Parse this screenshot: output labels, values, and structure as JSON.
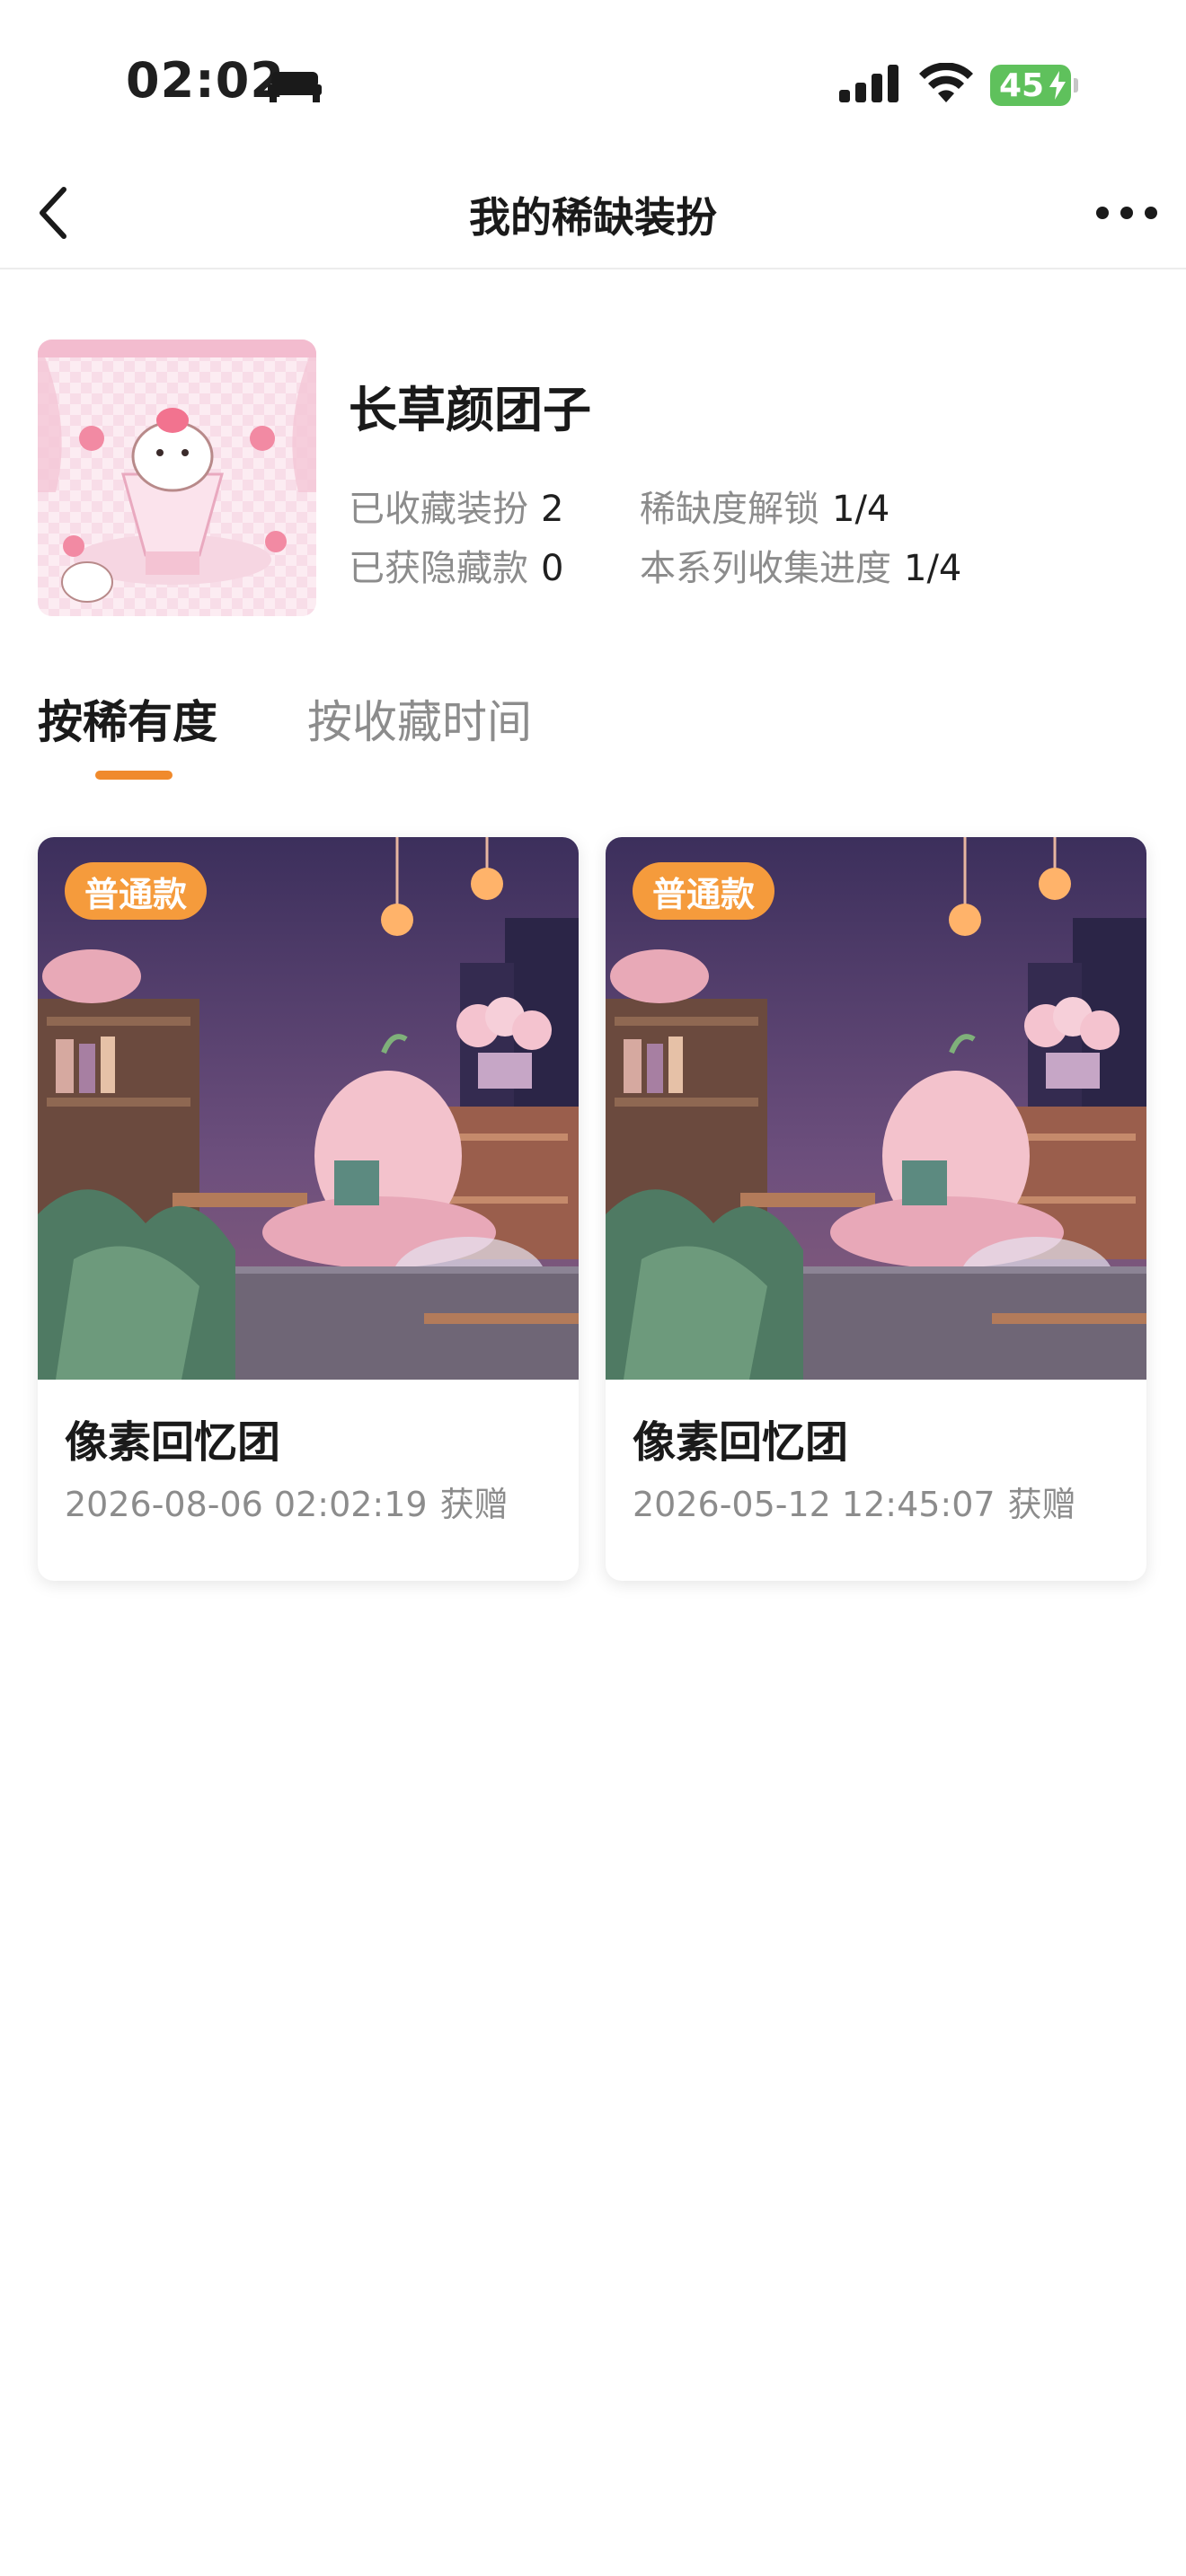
{
  "status_bar": {
    "time": "02:02",
    "battery": "45",
    "icons": [
      "bed-icon",
      "signal-icon",
      "wifi-icon",
      "battery-icon"
    ]
  },
  "nav": {
    "title": "我的稀缺装扮",
    "back_icon": "chevron-left-icon",
    "more_icon": "more-icon"
  },
  "series": {
    "name": "长草颜团子",
    "stats": [
      {
        "label": "已收藏装扮",
        "value": "2"
      },
      {
        "label": "稀缺度解锁",
        "value": "1/4"
      },
      {
        "label": "已获隐藏款",
        "value": "0"
      },
      {
        "label": "本系列收集进度",
        "value": "1/4"
      }
    ]
  },
  "tabs": [
    {
      "label": "按稀有度",
      "active": true
    },
    {
      "label": "按收藏时间",
      "active": false
    }
  ],
  "items": [
    {
      "badge": "普通款",
      "title": "像素回忆团",
      "time": "2026-08-06 02:02:19",
      "action": "获赠"
    },
    {
      "badge": "普通款",
      "title": "像素回忆团",
      "time": "2026-05-12 12:45:07",
      "action": "获赠"
    }
  ],
  "colors": {
    "accent": "#f08a2c",
    "badge": "#f59b3c",
    "battery": "#5fc15c",
    "muted_text": "#8c8c8c"
  }
}
